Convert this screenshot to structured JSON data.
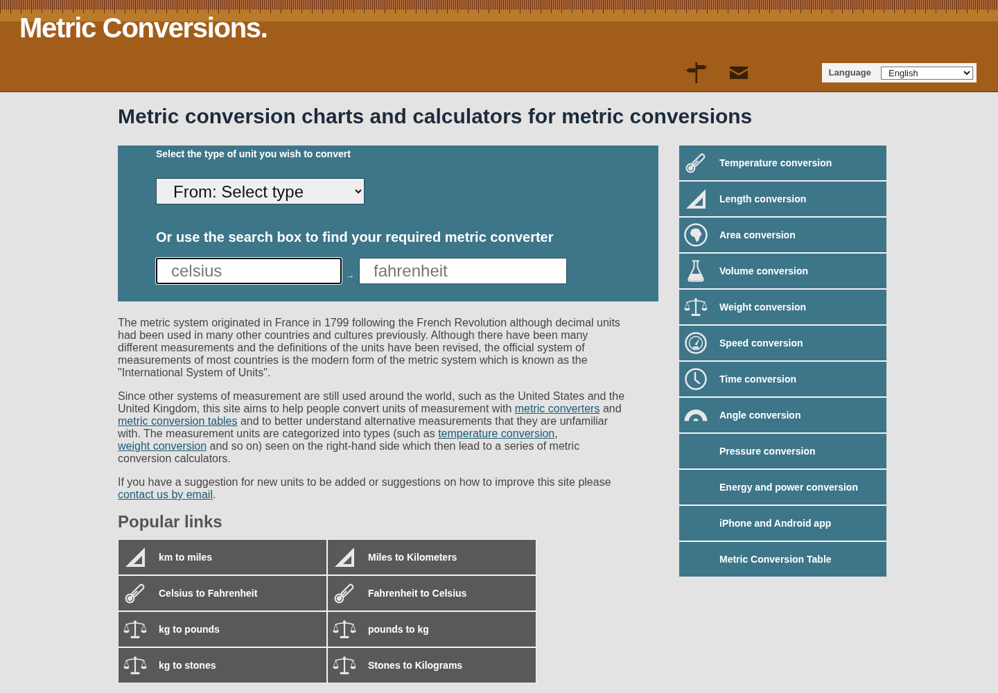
{
  "header": {
    "logo": "Metric Conversions.",
    "language_label": "Language",
    "language_value": "English"
  },
  "heading": "Metric conversion charts and calculators for metric conversions",
  "converter": {
    "label": "Select the type of unit you wish to convert",
    "type_select": "From: Select type",
    "search_heading": "Or use the search box to find your required metric converter",
    "search_fields": [
      {
        "placeholder": "celsius",
        "focused": true
      },
      {
        "placeholder": "fahrenheit",
        "focused": false
      }
    ],
    "arrow": "→"
  },
  "paragraphs": [
    [
      {
        "kind": "text",
        "text": "The metric system originated in France in 1799 following the French Revolution although decimal units had been used in many other countries and cultures previously. Although there have been many different measurements and the definitions of the units have been revised, the official system of measurements of most countries is the modern form of the metric system which is known as the \"International System of Units\"."
      }
    ],
    [
      {
        "kind": "text",
        "text": "Since other systems of measurement are still used around the world, such as the United States and the United Kingdom, this site aims to help people convert units of measurement with "
      },
      {
        "kind": "link",
        "text": "metric converters"
      },
      {
        "kind": "text",
        "text": " and "
      },
      {
        "kind": "link",
        "text": "metric conversion tables"
      },
      {
        "kind": "text",
        "text": " and to better understand alternative measurements that they are unfamiliar with. The measurement units are categorized into types (such as "
      },
      {
        "kind": "link",
        "text": "temperature conversion"
      },
      {
        "kind": "text",
        "text": ", "
      },
      {
        "kind": "link",
        "text": "weight conversion"
      },
      {
        "kind": "text",
        "text": " and so on) seen on the right-hand side which then lead to a series of metric conversion calculators."
      }
    ],
    [
      {
        "kind": "text",
        "text": "If you have a suggestion for new units to be added or suggestions on how to improve this site please "
      },
      {
        "kind": "link",
        "text": "contact us by email"
      },
      {
        "kind": "text",
        "text": "."
      }
    ]
  ],
  "popular": {
    "title": "Popular links",
    "links": [
      {
        "kind": "length",
        "label": "km to miles"
      },
      {
        "kind": "length",
        "label": "Miles to Kilometers"
      },
      {
        "kind": "temperature",
        "label": "Celsius to Fahrenheit"
      },
      {
        "kind": "temperature",
        "label": "Fahrenheit to Celsius"
      },
      {
        "kind": "weight",
        "label": "kg to pounds"
      },
      {
        "kind": "weight",
        "label": "pounds to kg"
      },
      {
        "kind": "weight",
        "label": "kg to stones"
      },
      {
        "kind": "weight",
        "label": "Stones to Kilograms"
      }
    ]
  },
  "sidebar": {
    "items": [
      {
        "kind": "temperature",
        "label": "Temperature conversion"
      },
      {
        "kind": "length",
        "label": "Length conversion"
      },
      {
        "kind": "area",
        "label": "Area conversion"
      },
      {
        "kind": "volume",
        "label": "Volume conversion"
      },
      {
        "kind": "weight",
        "label": "Weight conversion"
      },
      {
        "kind": "speed",
        "label": "Speed conversion"
      },
      {
        "kind": "time",
        "label": "Time conversion"
      },
      {
        "kind": "angle",
        "label": "Angle conversion"
      },
      {
        "kind": "plain",
        "label": "Pressure conversion"
      },
      {
        "kind": "plain",
        "label": "Energy and power conversion"
      },
      {
        "kind": "plain",
        "label": "iPhone and Android app"
      },
      {
        "kind": "plain",
        "label": "Metric Conversion Table"
      }
    ]
  }
}
